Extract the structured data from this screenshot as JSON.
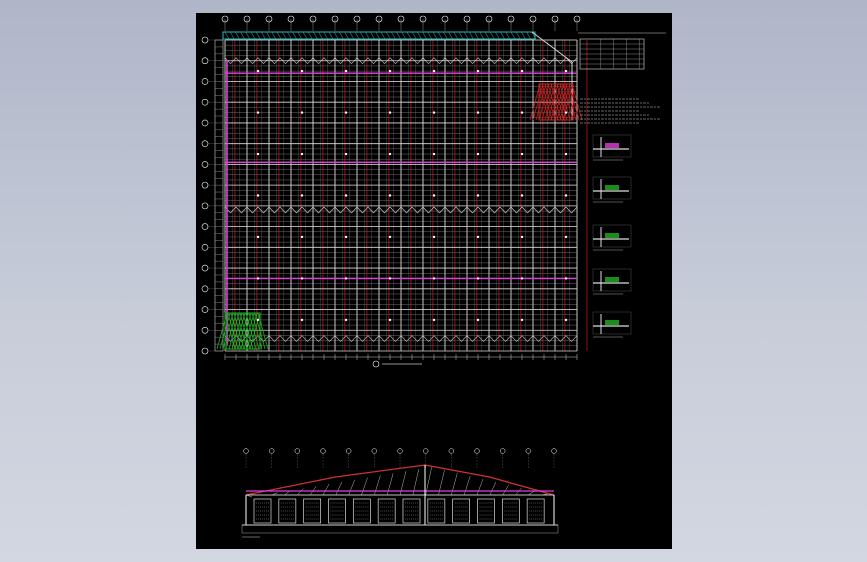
{
  "viewport": {
    "background": "#b8bfcf"
  },
  "sheet": {
    "background": "#000000"
  },
  "plan": {
    "title": "",
    "grid_cols": 16,
    "grid_rows": 15,
    "sub_rows_per_bay": 4,
    "purlin_subdiv": 3,
    "colors": {
      "beam": "#d8d8d8",
      "purlin": "#cc2222",
      "bracing": "#e040e0",
      "roof_edge": "#20c0c0",
      "grid_bubble": "#ffffff",
      "hatch_red": "#cc2020",
      "hatch_green": "#20b020"
    }
  },
  "notes_table": {
    "rows": 6,
    "cols": 5
  },
  "details": [
    {
      "name": "detail-1",
      "accent": "#e040e0"
    },
    {
      "name": "detail-2",
      "accent": "#20b020"
    },
    {
      "name": "detail-3",
      "accent": "#20b020"
    },
    {
      "name": "detail-4",
      "accent": "#20b020"
    },
    {
      "name": "detail-5",
      "accent": "#20b020"
    }
  ],
  "elevation": {
    "bays": 12,
    "door_count": 12,
    "colors": {
      "truss": "#cc3333",
      "frame": "#e040e0",
      "outline": "#ffffff"
    }
  }
}
